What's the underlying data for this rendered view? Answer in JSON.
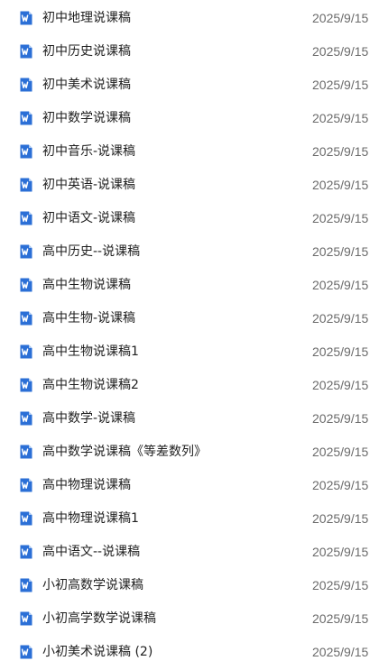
{
  "colors": {
    "name_text": "#1f1f1f",
    "date_text": "#6b6b6b",
    "word_icon_blue": "#2b6fd6",
    "word_icon_fold": "#a9c7f2"
  },
  "file_icon": "word-document-icon",
  "files": [
    {
      "name": "初中地理说课稿",
      "date": "2025/9/15"
    },
    {
      "name": "初中历史说课稿",
      "date": "2025/9/15"
    },
    {
      "name": "初中美术说课稿",
      "date": "2025/9/15"
    },
    {
      "name": "初中数学说课稿",
      "date": "2025/9/15"
    },
    {
      "name": "初中音乐-说课稿",
      "date": "2025/9/15"
    },
    {
      "name": "初中英语-说课稿",
      "date": "2025/9/15"
    },
    {
      "name": "初中语文-说课稿",
      "date": "2025/9/15"
    },
    {
      "name": "高中历史--说课稿",
      "date": "2025/9/15"
    },
    {
      "name": "高中生物说课稿",
      "date": "2025/9/15"
    },
    {
      "name": "高中生物-说课稿",
      "date": "2025/9/15"
    },
    {
      "name": "高中生物说课稿1",
      "date": "2025/9/15"
    },
    {
      "name": "高中生物说课稿2",
      "date": "2025/9/15"
    },
    {
      "name": "高中数学-说课稿",
      "date": "2025/9/15"
    },
    {
      "name": "高中数学说课稿《等差数列》",
      "date": "2025/9/15"
    },
    {
      "name": "高中物理说课稿",
      "date": "2025/9/15"
    },
    {
      "name": "高中物理说课稿1",
      "date": "2025/9/15"
    },
    {
      "name": "高中语文--说课稿",
      "date": "2025/9/15"
    },
    {
      "name": "小初高数学说课稿",
      "date": "2025/9/15"
    },
    {
      "name": "小初高学数学说课稿",
      "date": "2025/9/15"
    },
    {
      "name": "小初美术说课稿 (2)",
      "date": "2025/9/15"
    }
  ]
}
